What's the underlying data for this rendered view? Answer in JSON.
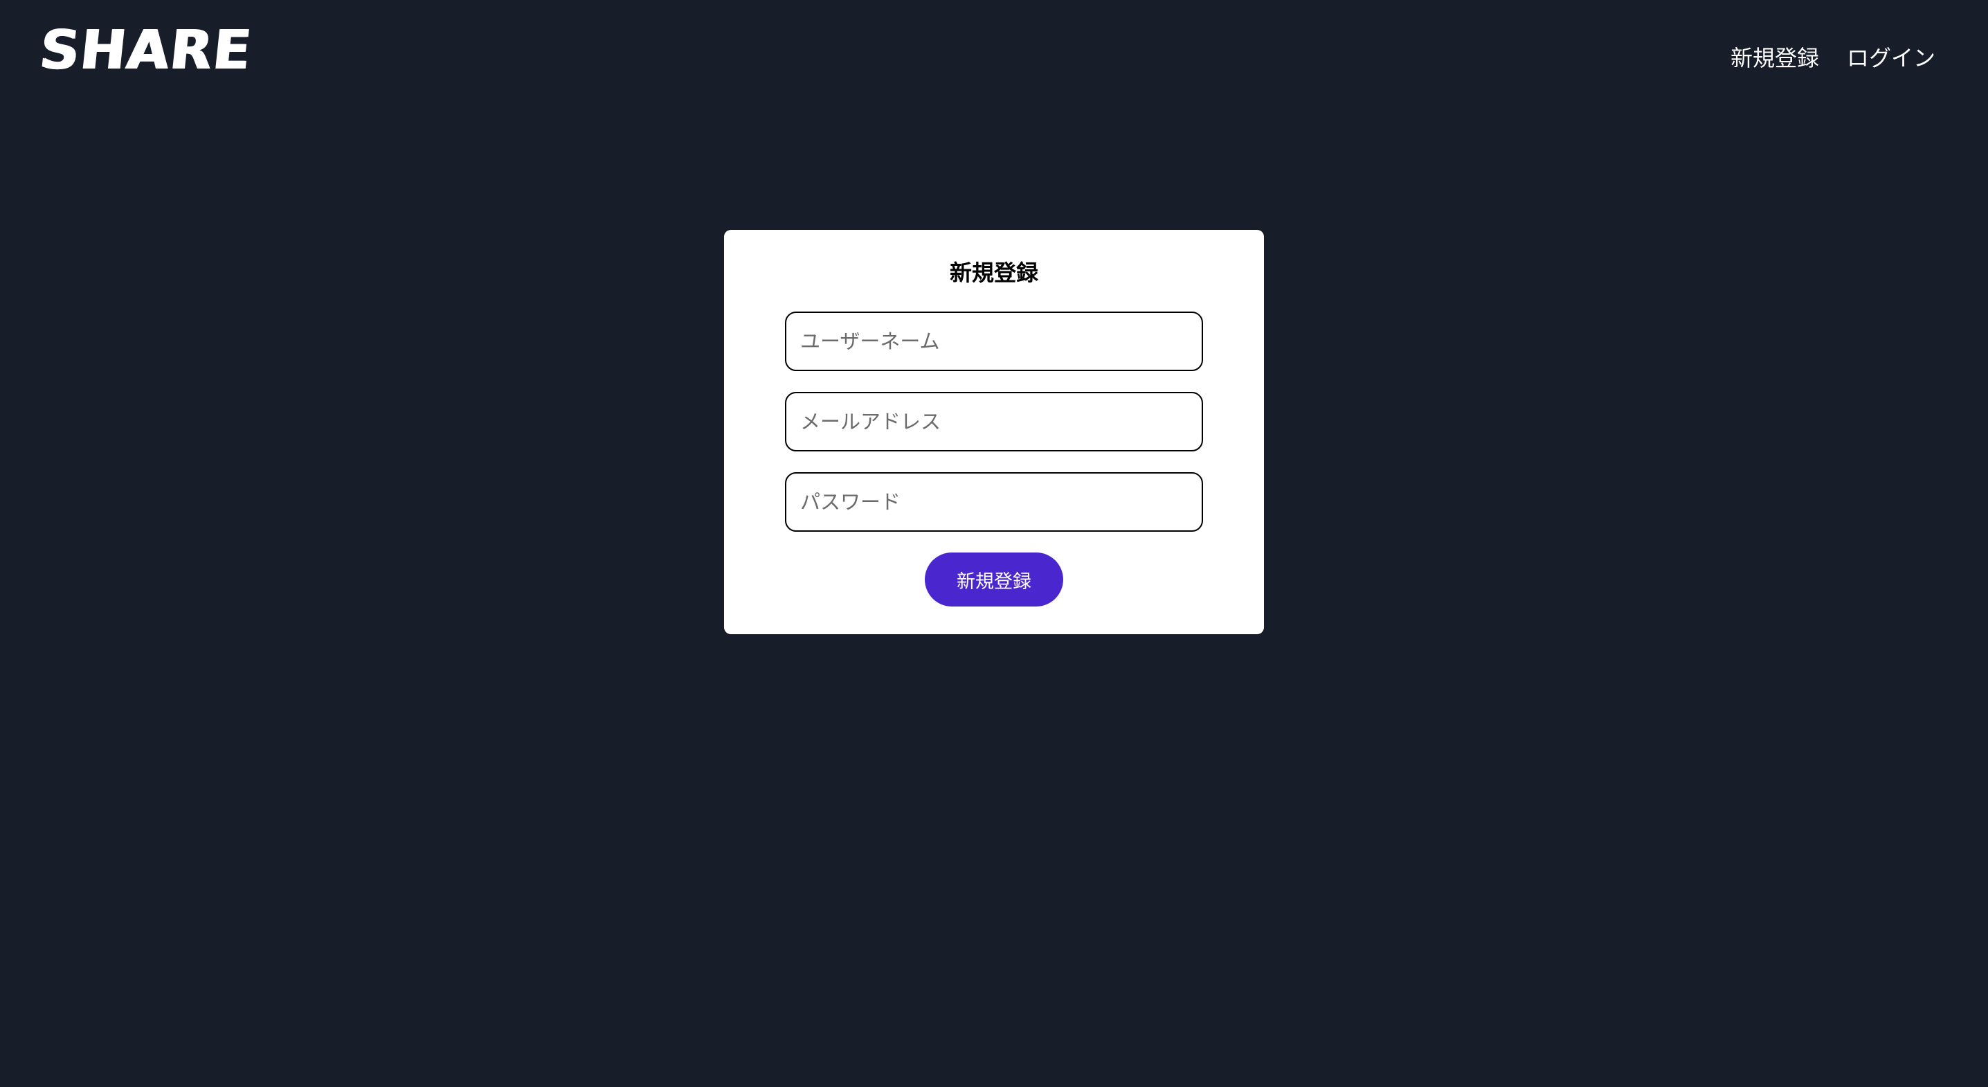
{
  "header": {
    "logo": "SHARE",
    "nav": {
      "signup": "新規登録",
      "login": "ログイン"
    }
  },
  "form": {
    "title": "新規登録",
    "username_placeholder": "ユーザーネーム",
    "email_placeholder": "メールアドレス",
    "password_placeholder": "パスワード",
    "submit_label": "新規登録"
  },
  "colors": {
    "background": "#181e29",
    "card": "#ffffff",
    "button": "#4a26cf"
  }
}
